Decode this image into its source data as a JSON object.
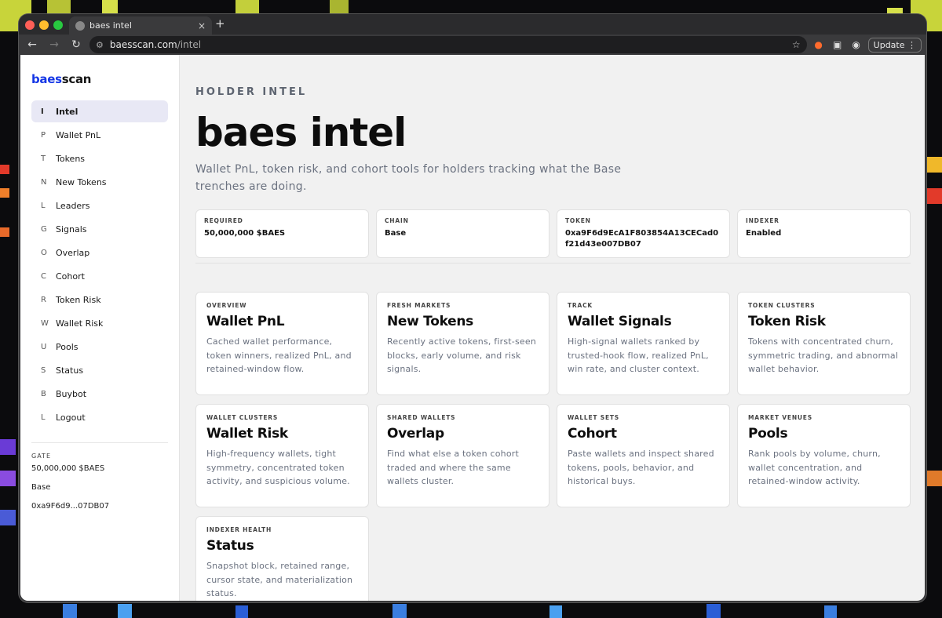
{
  "browser": {
    "tab_title": "baes intel",
    "tab_close": "×",
    "new_tab": "+",
    "url_host": "baesscan.com",
    "url_path": "/intel",
    "update_label": "Update",
    "more_label": "⋮"
  },
  "brand": {
    "part1": "baes",
    "part2": "scan"
  },
  "sidebar": {
    "items": [
      {
        "key": "I",
        "label": "Intel",
        "active": true
      },
      {
        "key": "P",
        "label": "Wallet PnL"
      },
      {
        "key": "T",
        "label": "Tokens"
      },
      {
        "key": "N",
        "label": "New Tokens"
      },
      {
        "key": "L",
        "label": "Leaders"
      },
      {
        "key": "G",
        "label": "Signals"
      },
      {
        "key": "O",
        "label": "Overlap"
      },
      {
        "key": "C",
        "label": "Cohort"
      },
      {
        "key": "R",
        "label": "Token Risk"
      },
      {
        "key": "W",
        "label": "Wallet Risk"
      },
      {
        "key": "U",
        "label": "Pools"
      },
      {
        "key": "S",
        "label": "Status"
      },
      {
        "key": "B",
        "label": "Buybot"
      },
      {
        "key": "L",
        "label": "Logout"
      }
    ],
    "gate": {
      "heading": "GATE",
      "required": "50,000,000 $BAES",
      "chain": "Base",
      "token_short": "0xa9F6d9...07DB07"
    }
  },
  "header": {
    "eyebrow": "HOLDER INTEL",
    "title": "baes intel",
    "description": "Wallet PnL, token risk, and cohort tools for holders tracking what the Base trenches are doing."
  },
  "stats": [
    {
      "label": "REQUIRED",
      "value": "50,000,000 $BAES"
    },
    {
      "label": "CHAIN",
      "value": "Base"
    },
    {
      "label": "TOKEN",
      "value": "0xa9F6d9EcA1F803854A13CECad0f21d43e007DB07"
    },
    {
      "label": "INDEXER",
      "value": "Enabled"
    }
  ],
  "cards": [
    {
      "kicker": "OVERVIEW",
      "title": "Wallet PnL",
      "desc": "Cached wallet performance, token winners, realized PnL, and retained-window flow."
    },
    {
      "kicker": "FRESH MARKETS",
      "title": "New Tokens",
      "desc": "Recently active tokens, first-seen blocks, early volume, and risk signals."
    },
    {
      "kicker": "TRACK",
      "title": "Wallet Signals",
      "desc": "High-signal wallets ranked by trusted-hook flow, realized PnL, win rate, and cluster context."
    },
    {
      "kicker": "TOKEN CLUSTERS",
      "title": "Token Risk",
      "desc": "Tokens with concentrated churn, symmetric trading, and abnormal wallet behavior."
    },
    {
      "kicker": "WALLET CLUSTERS",
      "title": "Wallet Risk",
      "desc": "High-frequency wallets, tight symmetry, concentrated token activity, and suspicious volume."
    },
    {
      "kicker": "SHARED WALLETS",
      "title": "Overlap",
      "desc": "Find what else a token cohort traded and where the same wallets cluster."
    },
    {
      "kicker": "WALLET SETS",
      "title": "Cohort",
      "desc": "Paste wallets and inspect shared tokens, pools, behavior, and historical buys."
    },
    {
      "kicker": "MARKET VENUES",
      "title": "Pools",
      "desc": "Rank pools by volume, churn, wallet concentration, and retained-window activity."
    },
    {
      "kicker": "INDEXER HEALTH",
      "title": "Status",
      "desc": "Snapshot block, retained range, cursor state, and materialization status."
    }
  ]
}
